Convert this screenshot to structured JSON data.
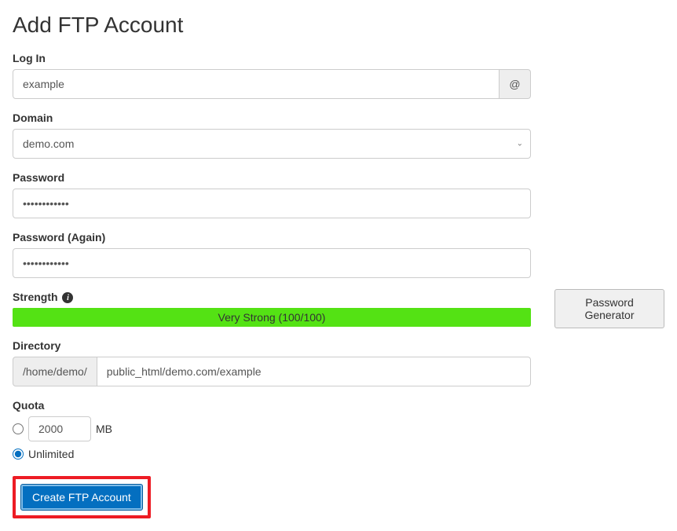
{
  "title": "Add FTP Account",
  "login": {
    "label": "Log In",
    "value": "example",
    "addon": "@"
  },
  "domain": {
    "label": "Domain",
    "value": "demo.com"
  },
  "password": {
    "label": "Password",
    "value": "••••••••••••"
  },
  "password_again": {
    "label": "Password (Again)",
    "value": "••••••••••••"
  },
  "strength": {
    "label": "Strength",
    "text": "Very Strong (100/100)"
  },
  "directory": {
    "label": "Directory",
    "prefix": "/home/demo/",
    "value": "public_html/demo.com/example"
  },
  "quota": {
    "label": "Quota",
    "value": "2000",
    "unit": "MB",
    "unlimited_label": "Unlimited"
  },
  "buttons": {
    "create": "Create FTP Account",
    "generator": "Password Generator"
  }
}
